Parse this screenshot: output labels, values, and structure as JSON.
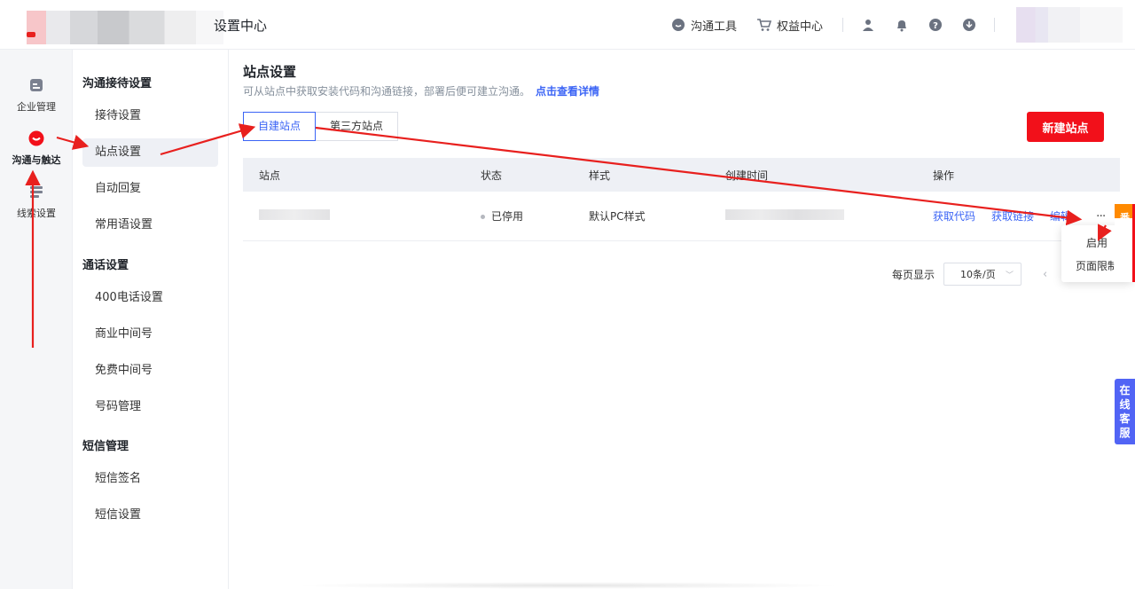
{
  "header": {
    "title": "设置中心",
    "tools": [
      {
        "label": "沟通工具",
        "icon": "chat-bubble-icon"
      },
      {
        "label": "权益中心",
        "icon": "cart-icon"
      }
    ]
  },
  "rail": {
    "items": [
      {
        "label": "企业管理",
        "icon": "building-icon"
      },
      {
        "label": "沟通与触达",
        "icon": "chat-reach-icon",
        "active": true
      },
      {
        "label": "线索设置",
        "icon": "list-icon"
      }
    ]
  },
  "submenu": {
    "groups": [
      {
        "title": "沟通接待设置",
        "items": [
          "接待设置",
          "站点设置",
          "自动回复",
          "常用语设置"
        ]
      },
      {
        "title": "通话设置",
        "items": [
          "400电话设置",
          "商业中间号",
          "免费中间号",
          "号码管理"
        ]
      },
      {
        "title": "短信管理",
        "items": [
          "短信签名",
          "短信设置"
        ]
      }
    ],
    "active": "站点设置"
  },
  "main": {
    "title": "站点设置",
    "desc": "可从站点中获取安装代码和沟通链接，部署后便可建立沟通。",
    "desc_link": "点击查看详情",
    "tabs": [
      {
        "label": "自建站点",
        "active": true
      },
      {
        "label": "第三方站点",
        "active": false
      }
    ],
    "new_button": "新建站点",
    "table": {
      "columns": [
        "站点",
        "状态",
        "样式",
        "创建时间",
        "操作"
      ],
      "rows": [
        {
          "status": "已停用",
          "style": "默认PC样式",
          "actions": [
            "获取代码",
            "获取链接",
            "编辑"
          ],
          "more": "···"
        }
      ]
    },
    "pager": {
      "label": "每页显示",
      "page_size": "10条/页",
      "prev": "‹"
    }
  },
  "dropdown": {
    "items": [
      "启用",
      "页面限制"
    ]
  },
  "side": {
    "orange_label": "番",
    "kefu_label": "在线客服"
  },
  "colors": {
    "accent": "#3b64f5",
    "brand_red": "#f2101a",
    "annotation_arrow": "#e8201e"
  }
}
